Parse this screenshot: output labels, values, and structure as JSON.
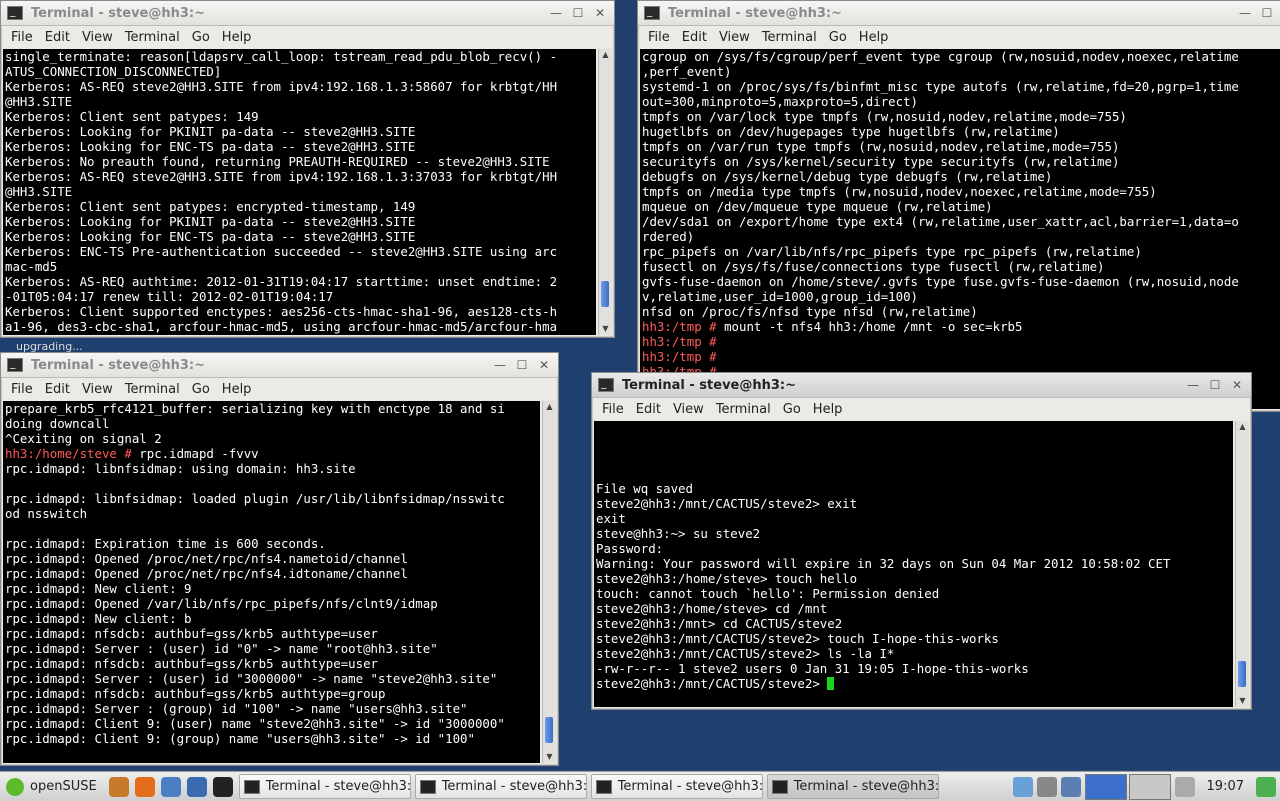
{
  "windows": {
    "w1": {
      "title": "Terminal - steve@hh3:~",
      "menu": [
        "File",
        "Edit",
        "View",
        "Terminal",
        "Go",
        "Help"
      ],
      "lines": [
        {
          "t": "single_terminate: reason[ldapsrv_call_loop: tstream_read_pdu_blob_recv() -"
        },
        {
          "t": "ATUS_CONNECTION_DISCONNECTED]"
        },
        {
          "t": "Kerberos: AS-REQ steve2@HH3.SITE from ipv4:192.168.1.3:58607 for krbtgt/HH"
        },
        {
          "t": "@HH3.SITE"
        },
        {
          "t": "Kerberos: Client sent patypes: 149"
        },
        {
          "t": "Kerberos: Looking for PKINIT pa-data -- steve2@HH3.SITE"
        },
        {
          "t": "Kerberos: Looking for ENC-TS pa-data -- steve2@HH3.SITE"
        },
        {
          "t": "Kerberos: No preauth found, returning PREAUTH-REQUIRED -- steve2@HH3.SITE"
        },
        {
          "t": "Kerberos: AS-REQ steve2@HH3.SITE from ipv4:192.168.1.3:37033 for krbtgt/HH"
        },
        {
          "t": "@HH3.SITE"
        },
        {
          "t": "Kerberos: Client sent patypes: encrypted-timestamp, 149"
        },
        {
          "t": "Kerberos: Looking for PKINIT pa-data -- steve2@HH3.SITE"
        },
        {
          "t": "Kerberos: Looking for ENC-TS pa-data -- steve2@HH3.SITE"
        },
        {
          "t": "Kerberos: ENC-TS Pre-authentication succeeded -- steve2@HH3.SITE using arc"
        },
        {
          "t": "mac-md5"
        },
        {
          "t": "Kerberos: AS-REQ authtime: 2012-01-31T19:04:17 starttime: unset endtime: 2"
        },
        {
          "t": "-01T05:04:17 renew till: 2012-02-01T19:04:17"
        },
        {
          "t": "Kerberos: Client supported enctypes: aes256-cts-hmac-sha1-96, aes128-cts-h"
        },
        {
          "t": "a1-96, des3-cbc-sha1, arcfour-hmac-md5, using arcfour-hmac-md5/arcfour-hma"
        }
      ]
    },
    "w2": {
      "title": "Terminal - steve@hh3:~",
      "menu": [
        "File",
        "Edit",
        "View",
        "Terminal",
        "Go",
        "Help"
      ],
      "lines": [
        {
          "t": "cgroup on /sys/fs/cgroup/perf_event type cgroup (rw,nosuid,nodev,noexec,relatime"
        },
        {
          "t": ",perf_event)"
        },
        {
          "t": "systemd-1 on /proc/sys/fs/binfmt_misc type autofs (rw,relatime,fd=20,pgrp=1,time"
        },
        {
          "t": "out=300,minproto=5,maxproto=5,direct)"
        },
        {
          "t": "tmpfs on /var/lock type tmpfs (rw,nosuid,nodev,relatime,mode=755)"
        },
        {
          "t": "hugetlbfs on /dev/hugepages type hugetlbfs (rw,relatime)"
        },
        {
          "t": "tmpfs on /var/run type tmpfs (rw,nosuid,nodev,relatime,mode=755)"
        },
        {
          "t": "securityfs on /sys/kernel/security type securityfs (rw,relatime)"
        },
        {
          "t": "debugfs on /sys/kernel/debug type debugfs (rw,relatime)"
        },
        {
          "t": "tmpfs on /media type tmpfs (rw,nosuid,nodev,noexec,relatime,mode=755)"
        },
        {
          "t": "mqueue on /dev/mqueue type mqueue (rw,relatime)"
        },
        {
          "t": "/dev/sda1 on /export/home type ext4 (rw,relatime,user_xattr,acl,barrier=1,data=o"
        },
        {
          "t": "rdered)"
        },
        {
          "t": "rpc_pipefs on /var/lib/nfs/rpc_pipefs type rpc_pipefs (rw,relatime)"
        },
        {
          "t": "fusectl on /sys/fs/fuse/connections type fusectl (rw,relatime)"
        },
        {
          "t": "gvfs-fuse-daemon on /home/steve/.gvfs type fuse.gvfs-fuse-daemon (rw,nosuid,node"
        },
        {
          "t": "v,relatime,user_id=1000,group_id=100)"
        },
        {
          "t": "nfsd on /proc/fs/nfsd type nfsd (rw,relatime)"
        },
        {
          "p": "hh3:/tmp # ",
          "c": "mount -t nfs4 hh3:/home /mnt -o sec=krb5"
        },
        {
          "p": "hh3:/tmp # ",
          "c": ""
        },
        {
          "p": "hh3:/tmp # ",
          "c": ""
        },
        {
          "p": "hh3:/tmp # ",
          "c": ""
        }
      ]
    },
    "w3": {
      "title": "Terminal - steve@hh3:~",
      "menu": [
        "File",
        "Edit",
        "View",
        "Terminal",
        "Go",
        "Help"
      ],
      "lines": [
        {
          "t": "prepare_krb5_rfc4121_buffer: serializing key with enctype 18 and si"
        },
        {
          "t": "doing downcall"
        },
        {
          "t": "^Cexiting on signal 2"
        },
        {
          "p": "hh3:/home/steve # ",
          "c": "rpc.idmapd -fvvv"
        },
        {
          "t": "rpc.idmapd: libnfsidmap: using domain: hh3.site"
        },
        {
          "t": ""
        },
        {
          "t": "rpc.idmapd: libnfsidmap: loaded plugin /usr/lib/libnfsidmap/nsswitc"
        },
        {
          "t": "od nsswitch"
        },
        {
          "t": ""
        },
        {
          "t": "rpc.idmapd: Expiration time is 600 seconds."
        },
        {
          "t": "rpc.idmapd: Opened /proc/net/rpc/nfs4.nametoid/channel"
        },
        {
          "t": "rpc.idmapd: Opened /proc/net/rpc/nfs4.idtoname/channel"
        },
        {
          "t": "rpc.idmapd: New client: 9"
        },
        {
          "t": "rpc.idmapd: Opened /var/lib/nfs/rpc_pipefs/nfs/clnt9/idmap"
        },
        {
          "t": "rpc.idmapd: New client: b"
        },
        {
          "t": "rpc.idmapd: nfsdcb: authbuf=gss/krb5 authtype=user"
        },
        {
          "t": "rpc.idmapd: Server : (user) id \"0\" -> name \"root@hh3.site\""
        },
        {
          "t": "rpc.idmapd: nfsdcb: authbuf=gss/krb5 authtype=user"
        },
        {
          "t": "rpc.idmapd: Server : (user) id \"3000000\" -> name \"steve2@hh3.site\""
        },
        {
          "t": "rpc.idmapd: nfsdcb: authbuf=gss/krb5 authtype=group"
        },
        {
          "t": "rpc.idmapd: Server : (group) id \"100\" -> name \"users@hh3.site\""
        },
        {
          "t": "rpc.idmapd: Client 9: (user) name \"steve2@hh3.site\" -> id \"3000000\""
        },
        {
          "t": "rpc.idmapd: Client 9: (group) name \"users@hh3.site\" -> id \"100\""
        }
      ]
    },
    "w4": {
      "title": "Terminal - steve@hh3:~",
      "menu": [
        "File",
        "Edit",
        "View",
        "Terminal",
        "Go",
        "Help"
      ],
      "lines": [
        {
          "t": ""
        },
        {
          "t": ""
        },
        {
          "t": ""
        },
        {
          "t": "",
          "gap": true
        },
        {
          "t": "File wq saved"
        },
        {
          "t": "steve2@hh3:/mnt/CACTUS/steve2> exit"
        },
        {
          "t": "exit"
        },
        {
          "t": "steve@hh3:~> su steve2"
        },
        {
          "t": "Password:"
        },
        {
          "t": "Warning: Your password will expire in 32 days on Sun 04 Mar 2012 10:58:02 CET"
        },
        {
          "t": "steve2@hh3:/home/steve> touch hello"
        },
        {
          "t": "touch: cannot touch `hello': Permission denied"
        },
        {
          "t": "steve2@hh3:/home/steve> cd /mnt"
        },
        {
          "t": "steve2@hh3:/mnt> cd CACTUS/steve2"
        },
        {
          "t": "steve2@hh3:/mnt/CACTUS/steve2> touch I-hope-this-works"
        },
        {
          "t": "steve2@hh3:/mnt/CACTUS/steve2> ls -la I*"
        },
        {
          "t": "-rw-r--r-- 1 steve2 users 0 Jan 31 19:05 I-hope-this-works"
        },
        {
          "t": "steve2@hh3:/mnt/CACTUS/steve2> ",
          "cursor": true
        }
      ]
    }
  },
  "upgrading_label": "upgrading...",
  "taskbar": {
    "start_label": "openSUSE",
    "tasks": [
      "Terminal - steve@hh3:~",
      "Terminal - steve@hh3:~",
      "Terminal - steve@hh3:~",
      "Terminal - steve@hh3:~"
    ],
    "clock": "19:07"
  },
  "icons": {
    "minimize": "minimize-icon",
    "maximize": "maximize-icon",
    "close": "close-icon"
  }
}
